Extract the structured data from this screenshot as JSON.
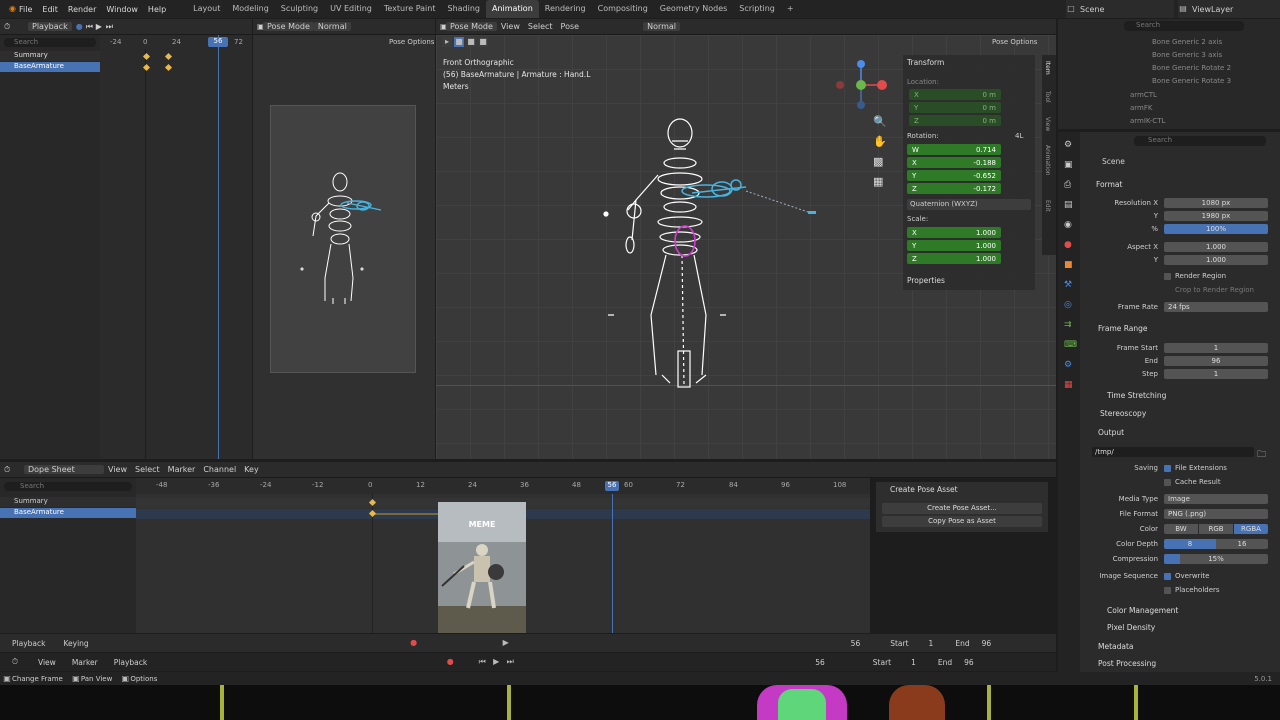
{
  "topbar": {
    "menus": [
      "File",
      "Edit",
      "Render",
      "Window",
      "Help"
    ],
    "workspaces": [
      "Layout",
      "Modeling",
      "Sculpting",
      "UV Editing",
      "Texture Paint",
      "Shading",
      "Animation",
      "Rendering",
      "Compositing",
      "Geometry Nodes",
      "Scripting"
    ],
    "active_workspace": "Animation",
    "add_tab": "+",
    "scene": "Scene",
    "view_layer": "ViewLayer"
  },
  "timeline_top": {
    "mode": "Playback",
    "ticks": [
      "-24",
      "0",
      "24",
      "48",
      "72"
    ],
    "current_frame": "56",
    "channels": [
      "Summary",
      "BaseArmature"
    ],
    "search_placeholder": "Search"
  },
  "camera_view": {
    "mode": "Pose Mode",
    "shading": "Normal",
    "pose_options": "Pose Options"
  },
  "viewport": {
    "mode": "Pose Mode",
    "menus": [
      "View",
      "Select",
      "Pose"
    ],
    "shading": "Normal",
    "pose_options": "Pose Options",
    "overlay_title": "Front Orthographic",
    "overlay_subtitle": "(56) BaseArmature | Armature : Hand.L",
    "overlay_units": "Meters"
  },
  "transform": {
    "title": "Transform",
    "location_label": "Location:",
    "location": [
      {
        "axis": "X",
        "value": "0 m"
      },
      {
        "axis": "Y",
        "value": "0 m"
      },
      {
        "axis": "Z",
        "value": "0 m"
      }
    ],
    "rotation_label": "Rotation:",
    "rotation_mode_short": "4L",
    "rotation": [
      {
        "axis": "W",
        "value": "0.714"
      },
      {
        "axis": "X",
        "value": "-0.188"
      },
      {
        "axis": "Y",
        "value": "-0.652"
      },
      {
        "axis": "Z",
        "value": "-0.172"
      }
    ],
    "rotation_mode": "Quaternion (WXYZ)",
    "scale_label": "Scale:",
    "scale": [
      {
        "axis": "X",
        "value": "1.000"
      },
      {
        "axis": "Y",
        "value": "1.000"
      },
      {
        "axis": "Z",
        "value": "1.000"
      }
    ],
    "properties": "Properties",
    "side_tabs": [
      "Item",
      "Tool",
      "View",
      "Animation",
      "Edit"
    ]
  },
  "outliner": {
    "items": [
      "Bone Generic 2 axis",
      "Bone Generic 3 axis",
      "Bone Generic Rotate 2",
      "Bone Generic Rotate 3",
      "armCTL",
      "armFK",
      "armIK-CTL"
    ],
    "search_placeholder": "Search"
  },
  "properties": {
    "search_placeholder": "Search",
    "scene": "Scene",
    "format_title": "Format",
    "resolution_x_label": "Resolution X",
    "resolution_x": "1080 px",
    "y_label": "Y",
    "resolution_y": "1980 px",
    "pct_label": "%",
    "resolution_pct": "100%",
    "aspect_x_label": "Aspect X",
    "aspect_x": "1.000",
    "aspect_y": "1.000",
    "render_region": "Render Region",
    "crop": "Crop to Render Region",
    "frame_rate_label": "Frame Rate",
    "frame_rate": "24 fps",
    "frame_range_title": "Frame Range",
    "frame_start_label": "Frame Start",
    "frame_start": "1",
    "end_label": "End",
    "frame_end": "96",
    "step_label": "Step",
    "frame_step": "1",
    "time_stretching": "Time Stretching",
    "stereoscopy": "Stereoscopy",
    "output_title": "Output",
    "output_path": "/tmp/",
    "saving_label": "Saving",
    "file_extensions": "File Extensions",
    "cache_result": "Cache Result",
    "media_type_label": "Media Type",
    "media_type": "Image",
    "file_format_label": "File Format",
    "file_format": "PNG (.png)",
    "color_label": "Color",
    "color_options": [
      "BW",
      "RGB",
      "RGBA"
    ],
    "color_depth_label": "Color Depth",
    "depth_options": [
      "8",
      "16"
    ],
    "compression_label": "Compression",
    "compression": "15%",
    "compression_level": 0.15,
    "image_sequence_label": "Image Sequence",
    "overwrite": "Overwrite",
    "placeholders": "Placeholders",
    "color_management": "Color Management",
    "pixel_density": "Pixel Density",
    "metadata": "Metadata",
    "post_processing": "Post Processing"
  },
  "dopesheet": {
    "mode": "Dope Sheet",
    "menus": [
      "View",
      "Select",
      "Marker",
      "Channel",
      "Key"
    ],
    "search_placeholder": "Search",
    "ticks": [
      "-48",
      "-36",
      "-24",
      "-12",
      "0",
      "12",
      "24",
      "36",
      "48",
      "56",
      "60",
      "72",
      "84",
      "96",
      "108"
    ],
    "channels": [
      "Summary",
      "BaseArmature"
    ],
    "meme_label": "MEME",
    "pose_panel_title": "Create Pose Asset",
    "create_button": "Create Pose Asset...",
    "copy_button": "Copy Pose as Asset",
    "playback": "Playback",
    "keying": "Keying",
    "current": "56",
    "start_label": "Start",
    "start": "1",
    "end_label": "End",
    "end": "96"
  },
  "bottom_timeline": {
    "menus": [
      "View",
      "Marker",
      "Playback"
    ],
    "current": "56",
    "start_label": "Start",
    "start": "1",
    "end_label": "End",
    "end": "96"
  },
  "statusbar": {
    "items": [
      "Change Frame",
      "Pan View",
      "Options"
    ],
    "version": "5.0.1"
  },
  "colors": {
    "accent": "#4772b3",
    "green_field": "#2f7a27",
    "keyframe": "#e8b84a",
    "selected_bone": "#47b3e0",
    "ik": "#d43bd4"
  }
}
